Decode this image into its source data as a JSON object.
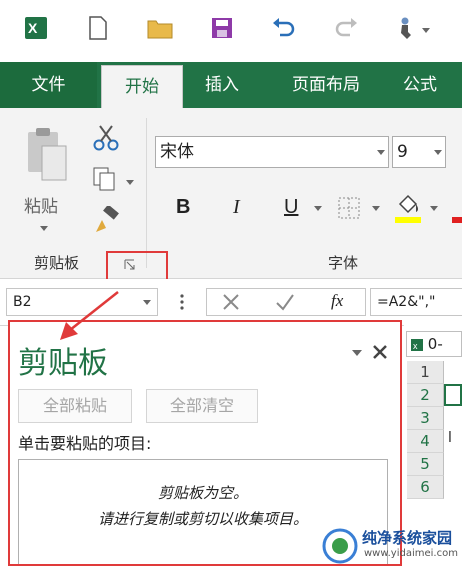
{
  "ribbon_tabs": [
    "文件",
    "开始",
    "插入",
    "页面布局",
    "公式"
  ],
  "clipboard_group": {
    "paste_label": "粘贴",
    "label": "剪贴板"
  },
  "font_group": {
    "font_name": "宋体",
    "font_size": "9",
    "bold": "B",
    "italic": "I",
    "underline": "U",
    "label": "字体"
  },
  "formula_bar": {
    "name_box": "B2",
    "fx": "fx",
    "formula": "=A2&\",\""
  },
  "clipboard_pane": {
    "title": "剪贴板",
    "paste_all": "全部粘贴",
    "clear_all": "全部清空",
    "instruction": "单击要粘贴的项目:",
    "empty_line1": "剪贴板为空。",
    "empty_line2": "请进行复制或剪切以收集项目。"
  },
  "sheet": {
    "tab_text": "0-",
    "rows": [
      "1",
      "2",
      "3",
      "4",
      "5",
      "6"
    ],
    "cell_row4": "l"
  },
  "watermark": {
    "brand": "纯净系统家园",
    "url": "www.yidaimei.com"
  },
  "colors": {
    "excel_green": "#217346",
    "annotation_red": "#e03a3a"
  }
}
